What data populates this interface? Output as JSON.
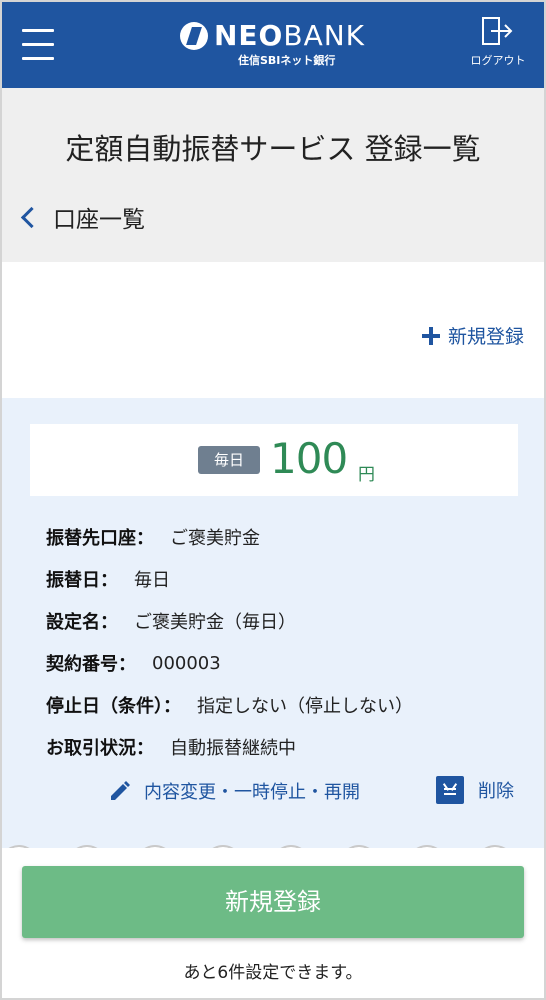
{
  "header": {
    "logo_main": "NEO",
    "logo_main2": "BANK",
    "logo_sub": "住信SBIネット銀行",
    "logout_label": "ログアウト",
    "icons": [
      "menu-icon",
      "logout-icon"
    ]
  },
  "page": {
    "title": "定額自動振替サービス 登録一覧",
    "back_label": "口座一覧",
    "new_link_label": "新規登録"
  },
  "card": {
    "frequency_badge": "毎日",
    "amount": "100",
    "unit": "円",
    "details": [
      {
        "key": "振替先口座：",
        "value": "ご褒美貯金"
      },
      {
        "key": "振替日：",
        "value": "毎日"
      },
      {
        "key": "設定名：",
        "value": "ご褒美貯金（毎日）"
      },
      {
        "key": "契約番号：",
        "value": "000003"
      },
      {
        "key": "停止日（条件）：",
        "value": "指定しない（停止しない）"
      },
      {
        "key": "お取引状況：",
        "value": "自動振替継続中"
      }
    ],
    "edit_label": "内容変更・一時停止・再開",
    "delete_label": "削除"
  },
  "footer": {
    "cta_label": "新規登録",
    "remaining_text": "あと6件設定できます。"
  },
  "colors": {
    "brand": "#1f55a0",
    "amount": "#2f8a56",
    "cta": "#6dbb86",
    "badge": "#6f7f90"
  }
}
